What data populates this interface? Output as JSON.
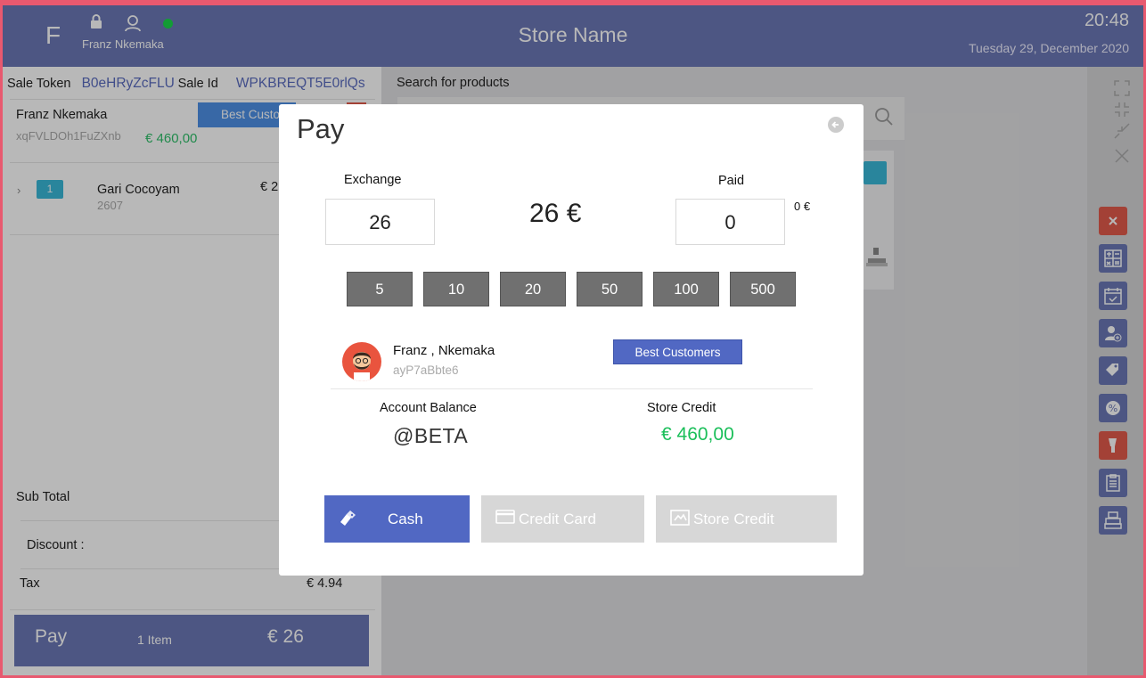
{
  "header": {
    "logo_letter": "F",
    "user_name": "Franz Nkemaka",
    "store_name": "Store Name",
    "time": "20:48",
    "date": "Tuesday 29, December  2020"
  },
  "sale": {
    "token_label": "Sale Token",
    "token_value": "B0eHRyZcFLU",
    "id_label": "Sale  Id",
    "id_value": "WPKBREQT5E0rlQs"
  },
  "customer": {
    "name": "Franz  Nkemaka",
    "id": "xqFVLDOh1FuZXnb",
    "balance": "€ 460,00",
    "group": "Best Custo"
  },
  "cart": {
    "items": [
      {
        "qty": "1",
        "name": "Gari Cocoyam",
        "code": "2607",
        "price": "€ 2"
      }
    ]
  },
  "summary": {
    "subtotal_label": "Sub Total",
    "discount_label": "Discount :",
    "tax_label": "Tax",
    "tax_value": "€ 4.94"
  },
  "pay_bar": {
    "label": "Pay",
    "items": "1 Item",
    "total": "€ 26"
  },
  "search": {
    "label": "Search for products"
  },
  "modal": {
    "title": "Pay",
    "exchange_label": "Exchange",
    "exchange_value": "26",
    "total": "26 €",
    "paid_label": "Paid",
    "paid_value": "0",
    "paid_small": "0 €",
    "quick_amounts": [
      "5",
      "10",
      "20",
      "50",
      "100",
      "500"
    ],
    "customer_name": "Franz , Nkemaka",
    "customer_id": "ayP7aBbte6",
    "customer_group": "Best Customers",
    "account_balance_label": "Account Balance",
    "account_balance_value": "@BETA",
    "store_credit_label": "Store Credit",
    "store_credit_value": "€ 460,00",
    "buttons": {
      "cash": "Cash",
      "credit_card": "Credit Card",
      "store_credit": "Store Credit"
    }
  },
  "colors": {
    "header": "#6b78b6",
    "accent_blue": "#5168c3",
    "green": "#1bbf5a",
    "red": "#e25a4c",
    "cyan": "#3ab9d8"
  }
}
